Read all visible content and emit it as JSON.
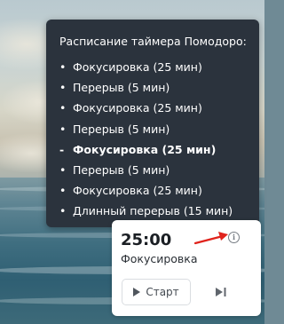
{
  "tooltip": {
    "title": "Расписание таймера Помодоро:",
    "items": [
      {
        "label": "Фокусировка (25 мин)",
        "current": false
      },
      {
        "label": "Перерыв (5 мин)",
        "current": false
      },
      {
        "label": "Фокусировка (25 мин)",
        "current": false
      },
      {
        "label": "Перерыв (5 мин)",
        "current": false
      },
      {
        "label": "Фокусировка (25 мин)",
        "current": true
      },
      {
        "label": "Перерыв (5 мин)",
        "current": false
      },
      {
        "label": "Фокусировка (25 мин)",
        "current": false
      },
      {
        "label": "Длинный перерыв (15 мин)",
        "current": false
      }
    ],
    "bullet": "•",
    "current_bullet": "-"
  },
  "timer": {
    "time": "25:00",
    "mode": "Фокусировка",
    "start_label": "Старт",
    "info_icon": "info-icon",
    "play_icon": "play-icon",
    "skip_icon": "skip-next-icon"
  },
  "colors": {
    "tooltip_bg": "#2b333d",
    "annotation_arrow": "#e0231c"
  }
}
